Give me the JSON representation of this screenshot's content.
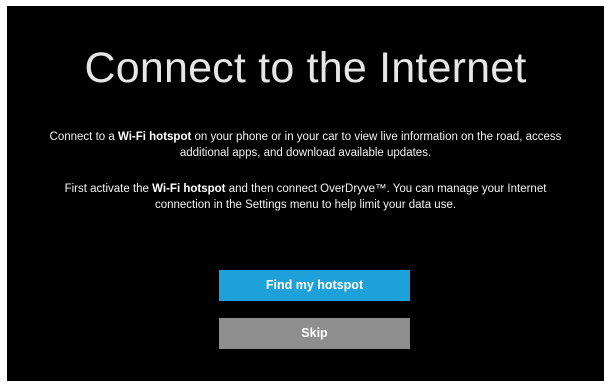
{
  "screen": {
    "title": "Connect to the Internet",
    "paragraph1": {
      "before": "Connect to a ",
      "bold": "Wi-Fi hotspot",
      "after": " on your phone or in your car to view live information on the road, access additional apps, and download available updates."
    },
    "paragraph2": {
      "before": "First activate the ",
      "bold": "Wi-Fi hotspot",
      "after": " and then connect OverDryve™. You can manage your Internet connection in the Settings menu to help limit your data use."
    }
  },
  "actions": {
    "primary_label": "Find my hotspot",
    "secondary_label": "Skip"
  },
  "colors": {
    "background": "#000000",
    "primary_button": "#1da1d8",
    "secondary_button": "#8e8e8e",
    "text": "#ffffff"
  }
}
